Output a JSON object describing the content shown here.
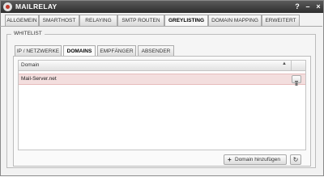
{
  "window": {
    "title": "MAILRELAY",
    "help": "?",
    "minimize": "–",
    "close": "×"
  },
  "main_tabs": [
    "ALLGEMEIN",
    "SMARTHOST",
    "RELAYING",
    "SMTP ROUTEN",
    "GREYLISTING",
    "DOMAIN MAPPING",
    "ERWEITERT"
  ],
  "main_active": "GREYLISTING",
  "section": {
    "legend": "WHITELIST"
  },
  "sub_tabs": [
    "IP / NETZWERKE",
    "DOMAINS",
    "EMPFÄNGER",
    "ABSENDER"
  ],
  "sub_active": "DOMAINS",
  "grid": {
    "column": "Domain",
    "sort_indicator": "▲",
    "rows": [
      "Mail-Server.net"
    ]
  },
  "buttons": {
    "add": "Domain hinzufügen",
    "add_icon": "+",
    "refresh_icon": "↻"
  }
}
